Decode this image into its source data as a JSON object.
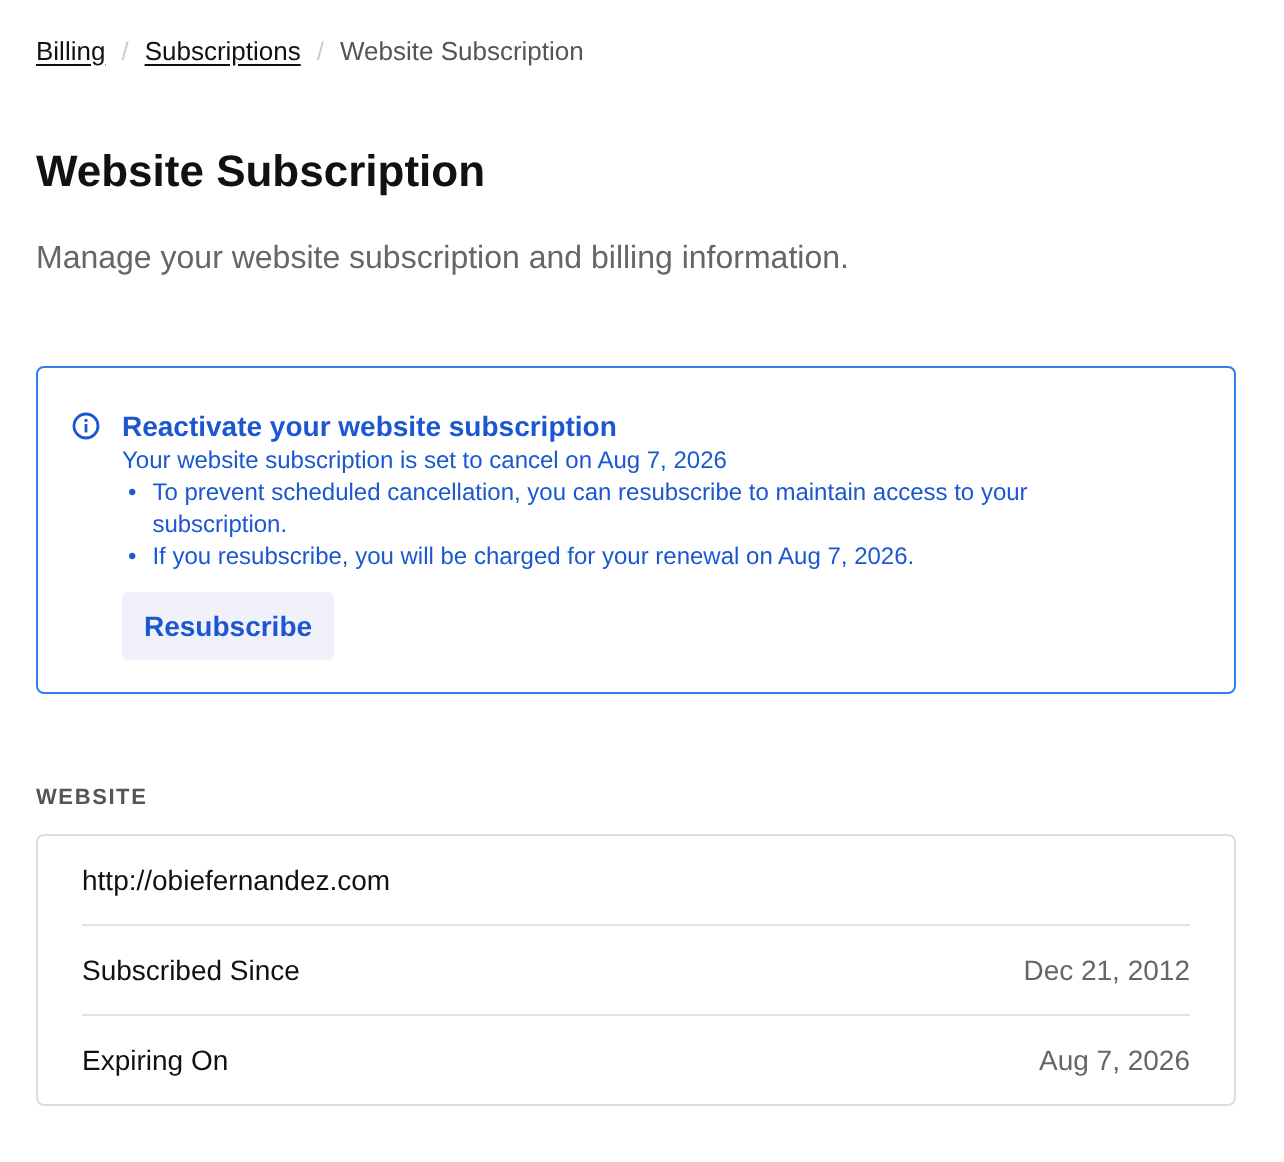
{
  "breadcrumb": [
    {
      "label": "Billing",
      "kind": "link"
    },
    {
      "label": "Subscriptions",
      "kind": "link"
    },
    {
      "label": "Website Subscription",
      "kind": "current"
    }
  ],
  "breadcrumb_separator": "/",
  "title": "Website Subscription",
  "subtitle": "Manage your website subscription and billing information.",
  "alert": {
    "title": "Reactivate your website subscription",
    "message": "Your website subscription is set to cancel on Aug 7, 2026",
    "bullet_marker": "•",
    "bullets": [
      "To prevent scheduled cancellation, you can resubscribe to maintain access to your subscription.",
      "If you resubscribe, you will be charged for your renewal on Aug 7, 2026."
    ],
    "button": "Resubscribe"
  },
  "section": {
    "heading": "WEBSITE",
    "rows": [
      {
        "label": "http://obiefernandez.com"
      },
      {
        "label": "Subscribed Since",
        "value": "Dec 21, 2012"
      },
      {
        "label": "Expiring On",
        "value": "Aug 7, 2026"
      }
    ]
  }
}
